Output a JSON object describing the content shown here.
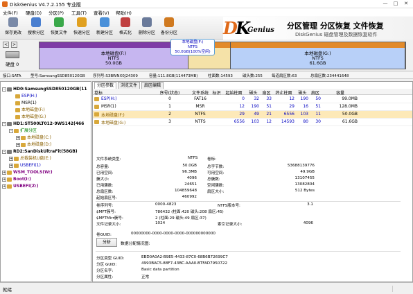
{
  "window": {
    "title": "DiskGenius V4.7.2.155 专业版",
    "minimize": "—",
    "maximize": "□",
    "close": "✕"
  },
  "menu": [
    "文件(F)",
    "硬盘(D)",
    "分区(P)",
    "工具(T)",
    "查看(V)",
    "帮助(H)"
  ],
  "toolbar": [
    {
      "label": "保存更改",
      "icon": "save-icon",
      "color": "#7a8aa8"
    },
    {
      "label": "搜索分区",
      "icon": "search-partition-icon",
      "color": "#4a7fd0"
    },
    {
      "label": "恢复文件",
      "icon": "recover-file-icon",
      "color": "#3aa84a"
    },
    {
      "label": "快速分区",
      "icon": "quick-partition-icon",
      "color": "#e0a020"
    },
    {
      "label": "新建分区",
      "icon": "new-partition-icon",
      "color": "#4a90d9"
    },
    {
      "label": "格式化",
      "icon": "format-icon",
      "color": "#c04040"
    },
    {
      "label": "删除分区",
      "icon": "delete-partition-icon",
      "color": "#6a7a9a"
    },
    {
      "label": "备份分区",
      "icon": "backup-partition-icon",
      "color": "#d07a20"
    }
  ],
  "banner": {
    "logo_d": "D",
    "logo_k": "K",
    "logo_text": "Genius",
    "slogan": "分区管理 分区恢复 文件恢复",
    "subtitle": "DiskGenius 磁盘管理及数据恢复软件"
  },
  "disk_panel": {
    "disk_label": "硬盘 0",
    "nav_prev": "<",
    "nav_next": ">"
  },
  "diskbar": [
    {
      "name": "本地磁盘(F:)",
      "fs": "NTFS",
      "size": "50.0GB",
      "fraction": 0.408,
      "top": "#7e3ca6",
      "body": "#c6b6f0"
    },
    {
      "name": "",
      "fs": "",
      "size": "",
      "fraction": 0.115,
      "top": "#e28a2a",
      "body": "#f5e2a8"
    },
    {
      "name": "本地磁盘(G:)",
      "fs": "NTFS",
      "size": "61.6GB",
      "fraction": 0.477,
      "top": "#e28a2a",
      "body": "#b8d0f8"
    }
  ],
  "tooltip": [
    "本地磁盘(F:)",
    "NTFS",
    "50.0GB(100%空闲)"
  ],
  "infobar": [
    "接口:SATA",
    "型号:SamsungSSD850120GB",
    "序列号:S3BWNX0J24309",
    "容量:111.8GB(114473MB)",
    "柱面数:14593",
    "磁头数:255",
    "每道扇区数:63",
    "总扇区数:234441648"
  ],
  "tree": [
    {
      "label": "HD0:SamsungSSD850120GB(11",
      "level": 0,
      "expander": "-",
      "icon": "disk-icon",
      "color": "#000"
    },
    {
      "label": "ESP(H:)",
      "level": 1,
      "expander": "",
      "icon": "partition-icon",
      "color": "#0000c0"
    },
    {
      "label": "MSR(1)",
      "level": 1,
      "expander": "",
      "icon": "partition-icon",
      "color": "#000"
    },
    {
      "label": "本地磁盘(F:)",
      "level": 1,
      "expander": "",
      "icon": "partition-icon",
      "color": "#8a6000"
    },
    {
      "label": "本地磁盘(G:)",
      "level": 1,
      "expander": "",
      "icon": "partition-icon",
      "color": "#8a6000"
    },
    {
      "label": "HD1:ST500LT012-9WS142(466",
      "level": 0,
      "expander": "-",
      "icon": "disk-icon",
      "color": "#000"
    },
    {
      "label": "扩展分区",
      "level": 1,
      "expander": "-",
      "icon": "partition-icon",
      "color": "#008000"
    },
    {
      "label": "本地磁盘(C:)",
      "level": 2,
      "expander": "+",
      "icon": "partition-icon",
      "color": "#8a6000"
    },
    {
      "label": "本地磁盘(D:)",
      "level": 2,
      "expander": "+",
      "icon": "partition-icon",
      "color": "#8a6000"
    },
    {
      "label": "RD2:SanDiskUltraFit(58GB)",
      "level": 0,
      "expander": "-",
      "icon": "disk-icon",
      "color": "#000"
    },
    {
      "label": "总裁装机U盘(E:)",
      "level": 1,
      "expander": "+",
      "icon": "partition-icon",
      "color": "#8a6000"
    },
    {
      "label": "USBEFI(1)",
      "level": 1,
      "expander": "+",
      "icon": "partition-icon",
      "color": "#0000c0"
    },
    {
      "label": "WSM_TOOLS(W:)",
      "level": 0,
      "expander": "+",
      "icon": "partition-icon",
      "color": "#800080"
    },
    {
      "label": "Boot(I:)",
      "level": 0,
      "expander": "+",
      "icon": "partition-icon",
      "color": "#800080"
    },
    {
      "label": "USBEFI(Z:)",
      "level": 0,
      "expander": "+",
      "icon": "partition-icon",
      "color": "#800080"
    }
  ],
  "tabs": [
    "分区参数",
    "浏览文件",
    "扇区编辑"
  ],
  "table": {
    "headers": [
      "卷标",
      "序号(状态)",
      "文件系统",
      "标识",
      "起始柱面",
      "磁头",
      "扇区",
      "终止柱面",
      "磁头",
      "扇区",
      "容量"
    ],
    "rows": [
      {
        "cells": [
          "ESP(H:)",
          "0",
          "FAT16",
          "",
          "0",
          "32",
          "33",
          "12",
          "190",
          "50",
          "99.0MB"
        ],
        "color": "#0000c0",
        "selected": false
      },
      {
        "cells": [
          "MSR(1)",
          "1",
          "MSR",
          "",
          "12",
          "190",
          "51",
          "29",
          "16",
          "51",
          "128.0MB"
        ],
        "color": "#000",
        "selected": false
      },
      {
        "cells": [
          "本地磁盘(F:)",
          "2",
          "NTFS",
          "",
          "29",
          "49",
          "21",
          "6556",
          "103",
          "11",
          "50.0GB"
        ],
        "color": "#8a6000",
        "selected": true
      },
      {
        "cells": [
          "本地磁盘(G:)",
          "3",
          "NTFS",
          "",
          "6556",
          "103",
          "12",
          "14593",
          "80",
          "30",
          "61.6GB"
        ],
        "color": "#8a6000",
        "selected": false
      }
    ]
  },
  "details": {
    "fs_type_label": "文件系统类型:",
    "fs_type_value": "NTFS",
    "volume_label": "卷标:",
    "left": [
      {
        "k": "总容量:",
        "v": "50.0GB"
      },
      {
        "k": "已用空间:",
        "v": "96.3MB"
      },
      {
        "k": "簇大小:",
        "v": "4096"
      },
      {
        "k": "已用簇数:",
        "v": "24651"
      },
      {
        "k": "总扇区数:",
        "v": "104859648"
      },
      {
        "k": "起始扇区号:",
        "v": "460992"
      }
    ],
    "right": [
      {
        "k": "总字节数:",
        "v": "53688139776"
      },
      {
        "k": "可用空间:",
        "v": "49.9GB"
      },
      {
        "k": "总簇数:",
        "v": "13107455"
      },
      {
        "k": "空闲簇数:",
        "v": "13082804"
      },
      {
        "k": "扇区大小:",
        "v": "512 Bytes"
      }
    ],
    "ntfs": [
      {
        "k": "卷序列号:",
        "v": "0000-4823",
        "k2": "NTFS版本号:",
        "v2": "3.1"
      },
      {
        "k": "$MFT簇号:",
        "v": "786432 (柱面:420 磁头:208 扇区:45)",
        "k2": "",
        "v2": ""
      },
      {
        "k": "$MFTMirr簇号:",
        "v": "2 (柱面:29 磁头:49 扇区:37)",
        "k2": "",
        "v2": ""
      },
      {
        "k": "文件记录大小:",
        "v": "1024",
        "k2": "索引记录大小:",
        "v2": "4096"
      }
    ],
    "guid_label": "卷GUID:",
    "guid_value": "00000000-0000-0000-0000-000000000000",
    "analyze_button": "分析",
    "allocation_label": "数据分配情况图:",
    "guids": [
      {
        "k": "分区类型 GUID:",
        "v": "EBD0A0A2-B9E5-4433-87C0-68B6B72699C7"
      },
      {
        "k": "分区 GUID:",
        "v": "4993BAC5-88F7-43BC-AAA0-BTFAD7950722"
      },
      {
        "k": "分区名字:",
        "v": "Basic data partition"
      },
      {
        "k": "分区属性:",
        "v": "正常"
      }
    ]
  },
  "status": {
    "text": "就绪"
  }
}
